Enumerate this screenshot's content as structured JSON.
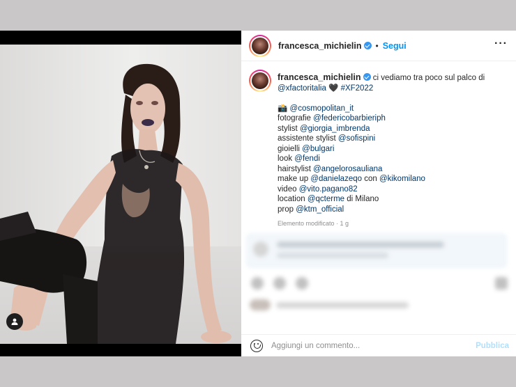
{
  "post": {
    "username": "francesca_michielin",
    "follow_label": "Segui",
    "separator": "•"
  },
  "caption": {
    "username": "francesca_michielin",
    "text_1": " ci vediamo tra poco sul palco di",
    "link_xfactor": "@xfactoritalia",
    "text_heart": " 🖤 ",
    "hashtag": "#XF2022",
    "camera_emoji": "📸",
    "link_cosmo": "@cosmopolitan_it",
    "label_fotografie": "fotografie ",
    "link_foto": "@federicobarbieriph",
    "label_stylist": "stylist ",
    "link_stylist": "@giorgia_imbrenda",
    "label_assistente": "assistente stylist ",
    "link_assistente": "@sofispini",
    "label_gioielli": "gioielli ",
    "link_gioielli": "@bulgari",
    "label_look": "look ",
    "link_look": "@fendi",
    "label_hair": "hairstylist ",
    "link_hair": "@angelorosauliana",
    "label_makeup": "make up ",
    "link_makeup": "@danielazeqo",
    "label_con": " con ",
    "link_kiko": "@kikomilano",
    "label_video": "video ",
    "link_video": "@vito.pagano82",
    "label_location": "location ",
    "link_location": "@qcterme",
    "label_milano": " di Milano",
    "label_prop": "prop ",
    "link_prop": "@ktm_official",
    "meta": "Elemento modificato · 1 g"
  },
  "comment_bar": {
    "placeholder": "Aggiungi un commento...",
    "publish_label": "Pubblica"
  },
  "icons": {
    "more": "more-options-icon",
    "emoji": "emoji-icon",
    "user_tag": "user-tag-icon",
    "verified": "verified-badge-icon"
  },
  "colors": {
    "link": "#00376b",
    "follow": "#0095f6",
    "verified": "#3897f0",
    "publish_disabled": "#b2dffc"
  }
}
